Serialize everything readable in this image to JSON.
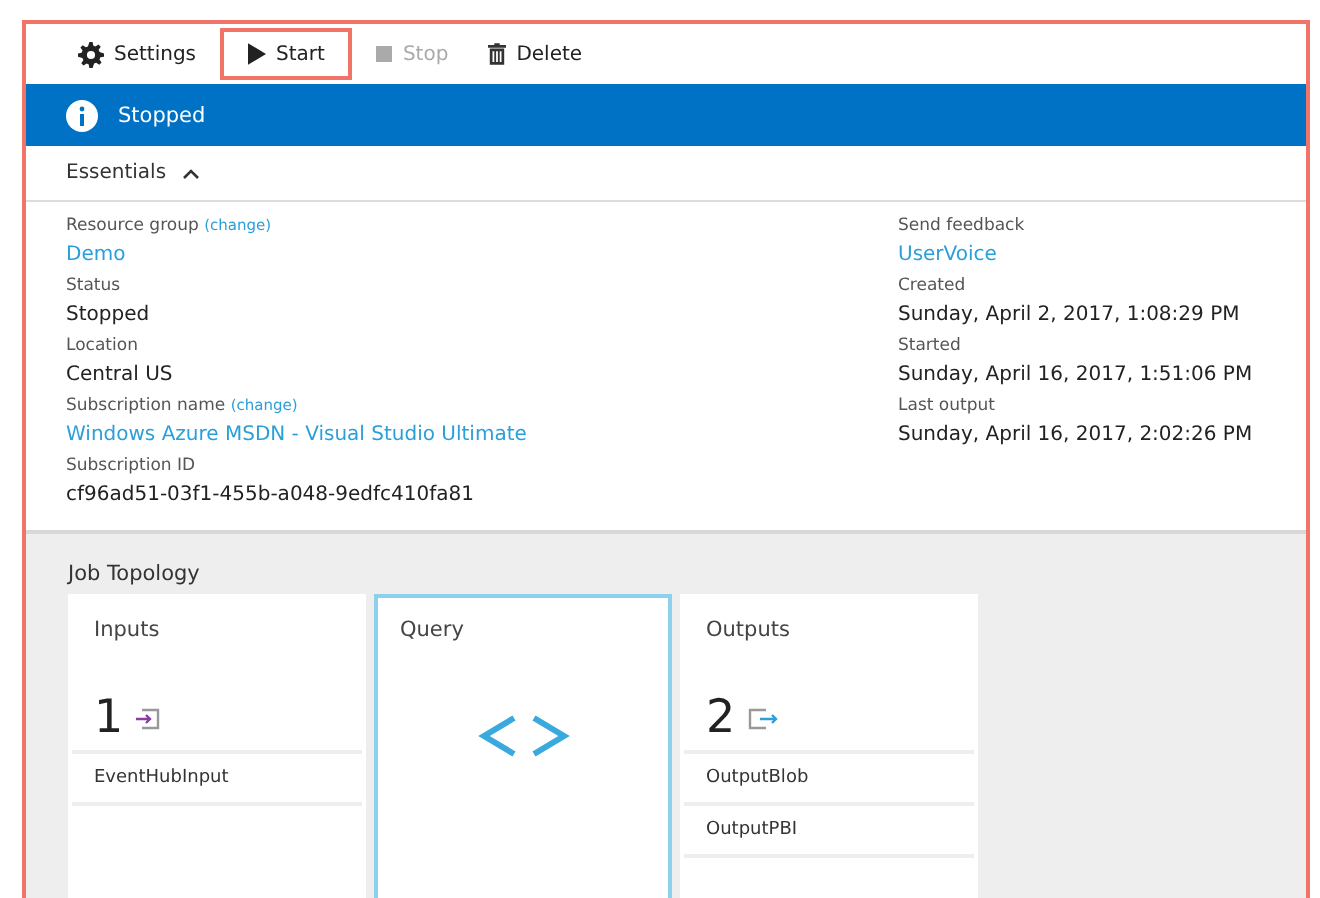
{
  "toolbar": [
    {
      "kind": "gear",
      "label": "Settings",
      "disabled": false,
      "highlighted": false
    },
    {
      "kind": "play",
      "label": "Start",
      "disabled": false,
      "highlighted": true
    },
    {
      "kind": "stop",
      "label": "Stop",
      "disabled": true,
      "highlighted": false
    },
    {
      "kind": "trash",
      "label": "Delete",
      "disabled": false,
      "highlighted": false
    }
  ],
  "status_banner": {
    "text": "Stopped"
  },
  "essentials": {
    "title": "Essentials",
    "expanded": true,
    "left": [
      {
        "label": "Resource group",
        "change": "(change)",
        "value": "Demo",
        "link": true
      },
      {
        "label": "Status",
        "value": "Stopped",
        "link": false
      },
      {
        "label": "Location",
        "value": "Central US",
        "link": false
      },
      {
        "label": "Subscription name",
        "change": "(change)",
        "value": "Windows Azure MSDN - Visual Studio Ultimate",
        "link": true
      },
      {
        "label": "Subscription ID",
        "value": "cf96ad51-03f1-455b-a048-9edfc410fa81",
        "link": false
      }
    ],
    "right": [
      {
        "label": "Send feedback",
        "value": "UserVoice",
        "link": true
      },
      {
        "label": "Created",
        "value": "Sunday, April 2, 2017, 1:08:29 PM",
        "link": false
      },
      {
        "label": "Started",
        "value": "Sunday, April 16, 2017, 1:51:06 PM",
        "link": false
      },
      {
        "label": "Last output",
        "value": "Sunday, April 16, 2017, 2:02:26 PM",
        "link": false
      }
    ]
  },
  "job_topology": {
    "title": "Job Topology",
    "cards": [
      {
        "kind": "inputs",
        "title": "Inputs",
        "count": "1",
        "selected": false,
        "items": [
          "EventHubInput"
        ]
      },
      {
        "kind": "query",
        "title": "Query",
        "selected": true
      },
      {
        "kind": "outputs",
        "title": "Outputs",
        "count": "2",
        "selected": false,
        "items": [
          "OutputBlob",
          "OutputPBI"
        ]
      }
    ]
  }
}
